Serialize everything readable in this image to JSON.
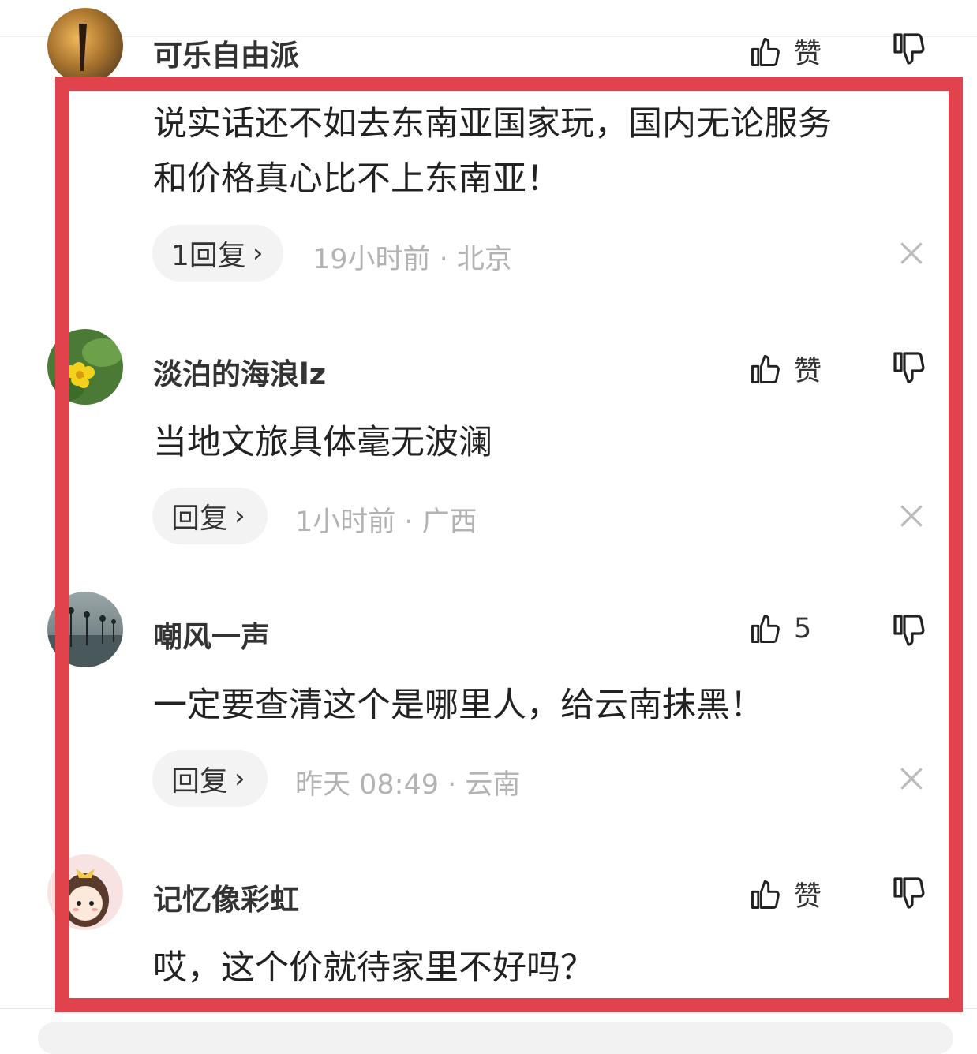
{
  "comments": [
    {
      "username": "可乐自由派",
      "like_label": "赞",
      "avatar": "sunset-silhouette-avatar"
    },
    {
      "text_line1": "说实话还不如去东南亚国家玩，国内无论服务",
      "text_line2": "和价格真心比不上东南亚！",
      "reply_label": "1回复",
      "meta": "19小时前 · 北京"
    },
    {
      "username": "淡泊的海浪lz",
      "like_label": "赞",
      "text": "当地文旅具体毫无波澜",
      "reply_label": "回复",
      "meta": "1小时前 · 广西",
      "avatar": "yellow-flower-avatar"
    },
    {
      "username": "嘲风一声",
      "like_label": "5",
      "text": "一定要查清这个是哪里人，给云南抹黑！",
      "reply_label": "回复",
      "meta": "昨天 08:49 · 云南",
      "avatar": "stilt-fishermen-avatar"
    },
    {
      "username": "记忆像彩虹",
      "like_label": "赞",
      "text": "哎，这个价就待家里不好吗？",
      "avatar": "cartoon-girl-avatar"
    }
  ],
  "colors": {
    "highlight_border": "#e0434b",
    "meta_text": "#b3b3b3",
    "reply_bg": "#f3f3f3"
  }
}
